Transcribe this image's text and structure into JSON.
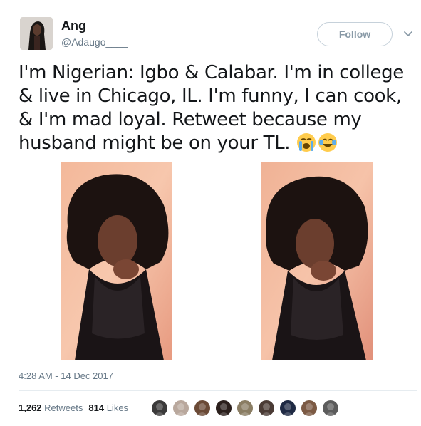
{
  "user": {
    "name": "Ang",
    "handle": "@Adaugo____",
    "follow_label": "Follow"
  },
  "tweet": {
    "text": "I'm Nigerian: Igbo & Calabar. I'm in college & live in Chicago, IL. I'm funny, I can cook, & I'm mad loyal. Retweet because my husband might be on your TL.",
    "emojis": [
      "loudly-crying-face",
      "face-with-tears-of-joy"
    ]
  },
  "timestamp": "4:28 AM - 14 Dec 2017",
  "stats": {
    "retweets_count": "1,262",
    "retweets_label": "Retweets",
    "likes_count": "814",
    "likes_label": "Likes"
  },
  "colors": {
    "text": "#14171a",
    "secondary": "#657786",
    "button_border": "#c6d1da",
    "divider": "#e6ecf0"
  },
  "likers": [
    {
      "color": "#3b3a3a"
    },
    {
      "color": "#b9a89d"
    },
    {
      "color": "#6b4a36"
    },
    {
      "color": "#2b1f1c"
    },
    {
      "color": "#8a7d63"
    },
    {
      "color": "#4a3b35"
    },
    {
      "color": "#1f2a44"
    },
    {
      "color": "#7c5a44"
    },
    {
      "color": "#5c5c5c"
    }
  ]
}
